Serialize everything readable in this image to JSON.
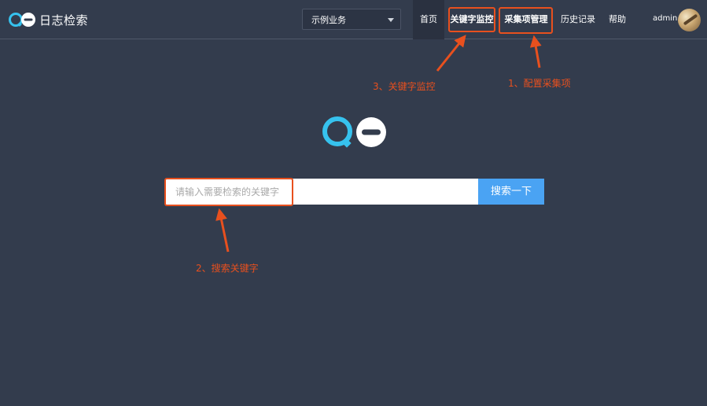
{
  "header": {
    "logo_text": "日志检索",
    "business_select": {
      "value": "示例业务",
      "icon": "caret-down-icon"
    },
    "nav": {
      "home": "首页",
      "keyword_monitor": "关键字监控",
      "collect_manage": "采集项管理",
      "history": "历史记录",
      "help": "帮助"
    },
    "user": {
      "name": "admin"
    }
  },
  "search": {
    "placeholder": "请输入需要检索的关键字",
    "value": "",
    "button_label": "搜索一下"
  },
  "annotations": {
    "step1": "1、配置采集项",
    "step2": "2、搜索关键字",
    "step3": "3、关键字监控"
  },
  "colors": {
    "background": "#333c4d",
    "accent": "#4aa3f3",
    "highlight": "#e8501e",
    "logo_cyan": "#36c2ee"
  }
}
